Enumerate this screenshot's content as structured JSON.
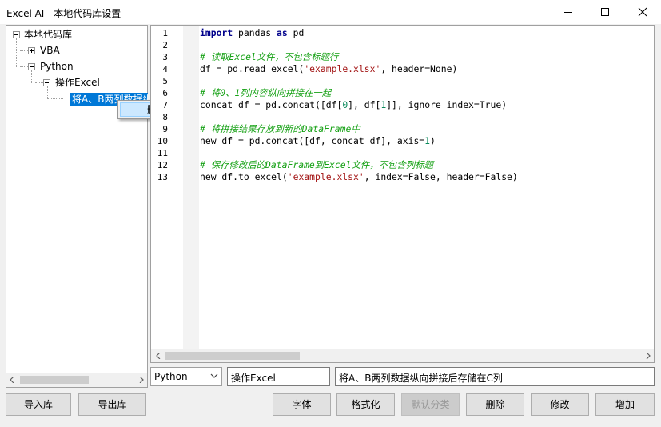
{
  "window": {
    "title": "Excel AI - 本地代码库设置"
  },
  "tree": {
    "root": "本地代码库",
    "vba": "VBA",
    "python": "Python",
    "excel_folder": "操作Excel",
    "selected_item": "将A、B两列数据纵向拼接后存储在C列"
  },
  "context_menu": {
    "delete": "删除"
  },
  "editor": {
    "lines": [
      {
        "n": "1",
        "t": "import pandas as pd"
      },
      {
        "n": "2",
        "t": ""
      },
      {
        "n": "3",
        "t": "# 读取Excel文件，不包含标题行"
      },
      {
        "n": "4",
        "t": "df = pd.read_excel('example.xlsx', header=None)"
      },
      {
        "n": "5",
        "t": ""
      },
      {
        "n": "6",
        "t": "# 将0、1列内容纵向拼接在一起"
      },
      {
        "n": "7",
        "t": "concat_df = pd.concat([df[0], df[1]], ignore_index=True)"
      },
      {
        "n": "8",
        "t": ""
      },
      {
        "n": "9",
        "t": "# 将拼接结果存放到新的DataFrame中"
      },
      {
        "n": "10",
        "t": "new_df = pd.concat([df, concat_df], axis=1)"
      },
      {
        "n": "11",
        "t": ""
      },
      {
        "n": "12",
        "t": "# 保存修改后的DataFrame到Excel文件，不包含列标题"
      },
      {
        "n": "13",
        "t": "new_df.to_excel('example.xlsx', index=False, header=False)"
      }
    ]
  },
  "fields": {
    "language": "Python",
    "name": "操作Excel",
    "description": "将A、B两列数据纵向拼接后存储在C列"
  },
  "buttons": {
    "import": "导入库",
    "export": "导出库",
    "font": "字体",
    "format": "格式化",
    "default_category": "默认分类",
    "delete": "删除",
    "modify": "修改",
    "add": "增加"
  },
  "icons": {
    "minimize": "minimize-icon",
    "maximize": "maximize-icon",
    "close": "close-icon",
    "dropdown": "chevron-down-icon"
  }
}
